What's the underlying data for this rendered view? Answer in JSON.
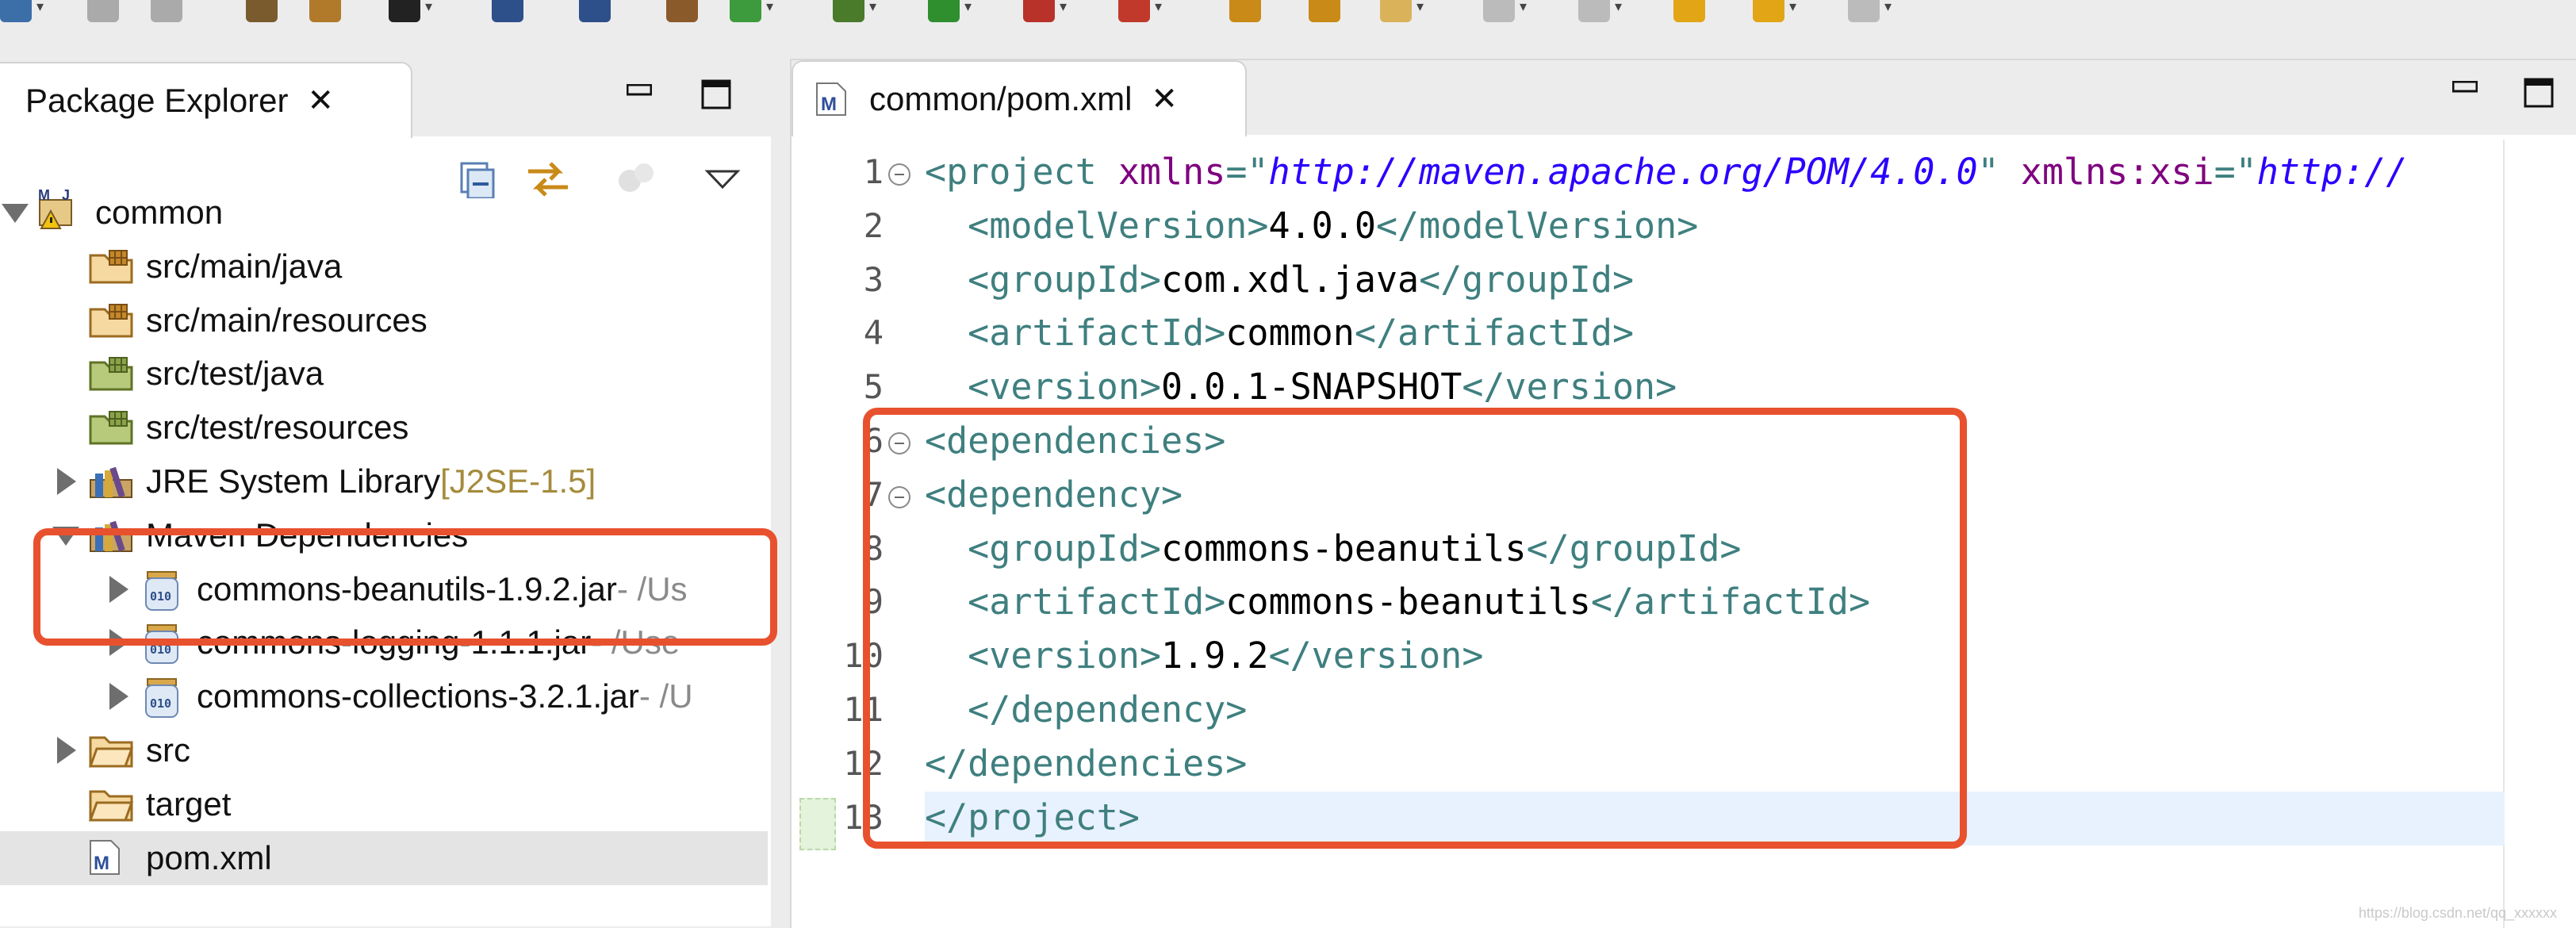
{
  "toolbar": {
    "items": [
      "new-icon",
      "save-icon",
      "save-all-icon",
      "tool-icon",
      "refresh-icon",
      "avatar-icon",
      "monitor-icon",
      "search-icon",
      "package-icon",
      "sync-icon",
      "debug-icon",
      "run-icon",
      "run-config-icon",
      "external-tools-icon",
      "open-folder-icon",
      "open-file-icon",
      "pen-icon",
      "task-icon",
      "up-icon",
      "back-icon",
      "back-history-icon",
      "forward-icon"
    ]
  },
  "explorer": {
    "title": "Package Explorer",
    "tree": [
      {
        "label": "common",
        "icon": "maven-project-icon",
        "expanded": true,
        "level": 0
      },
      {
        "label": "src/main/java",
        "icon": "source-folder-icon",
        "level": 1
      },
      {
        "label": "src/main/resources",
        "icon": "source-folder-icon",
        "level": 1
      },
      {
        "label": "src/test/java",
        "icon": "test-source-folder-icon",
        "level": 1
      },
      {
        "label": "src/test/resources",
        "icon": "test-source-folder-icon",
        "level": 1
      },
      {
        "label": "JRE System Library",
        "decoration": "[J2SE-1.5]",
        "icon": "library-icon",
        "expanded": false,
        "level": 1
      },
      {
        "label": "Maven Dependencies",
        "icon": "library-icon",
        "expanded": true,
        "level": 1
      },
      {
        "label": "commons-beanutils-1.9.2.jar",
        "path": "- /Us",
        "icon": "jar-icon",
        "expanded": false,
        "level": 2
      },
      {
        "label": "commons-logging-1.1.1.jar",
        "path": "- /Use",
        "icon": "jar-icon",
        "expanded": false,
        "level": 2
      },
      {
        "label": "commons-collections-3.2.1.jar",
        "path": "- /U",
        "icon": "jar-icon",
        "expanded": false,
        "level": 2
      },
      {
        "label": "src",
        "icon": "folder-icon",
        "expanded": false,
        "level": 1
      },
      {
        "label": "target",
        "icon": "folder-icon",
        "level": 1
      },
      {
        "label": "pom.xml",
        "icon": "pom-file-icon",
        "selected": true,
        "level": 1
      }
    ]
  },
  "editor": {
    "tab_label": "common/pom.xml",
    "lines": [
      {
        "num": "1",
        "fold": true,
        "tokens": [
          [
            "tag",
            "<project "
          ],
          [
            "attr",
            "xmlns"
          ],
          [
            "tag",
            "=\""
          ],
          [
            "val",
            "http://maven.apache.org/POM/4.0.0"
          ],
          [
            "tag",
            "\" "
          ],
          [
            "attr",
            "xmlns:xsi"
          ],
          [
            "tag",
            "=\""
          ],
          [
            "val",
            "http://"
          ]
        ]
      },
      {
        "num": "2",
        "tokens": [
          [
            "tag",
            "  <modelVersion>"
          ],
          [
            "text",
            "4.0.0"
          ],
          [
            "tag",
            "</modelVersion>"
          ]
        ]
      },
      {
        "num": "3",
        "tokens": [
          [
            "tag",
            "  <groupId>"
          ],
          [
            "text",
            "com.xdl.java"
          ],
          [
            "tag",
            "</groupId>"
          ]
        ]
      },
      {
        "num": "4",
        "tokens": [
          [
            "tag",
            "  <artifactId>"
          ],
          [
            "text",
            "common"
          ],
          [
            "tag",
            "</artifactId>"
          ]
        ]
      },
      {
        "num": "5",
        "tokens": [
          [
            "tag",
            "  <version>"
          ],
          [
            "text",
            "0.0.1-SNAPSHOT"
          ],
          [
            "tag",
            "</version>"
          ]
        ]
      },
      {
        "num": "6",
        "fold": true,
        "tokens": [
          [
            "tag",
            "<dependencies>"
          ]
        ]
      },
      {
        "num": "7",
        "fold": true,
        "tokens": [
          [
            "tag",
            "<dependency>"
          ]
        ]
      },
      {
        "num": "8",
        "tokens": [
          [
            "tag",
            "  <groupId>"
          ],
          [
            "text",
            "commons-beanutils"
          ],
          [
            "tag",
            "</groupId>"
          ]
        ]
      },
      {
        "num": "9",
        "tokens": [
          [
            "tag",
            "  <artifactId>"
          ],
          [
            "text",
            "commons-beanutils"
          ],
          [
            "tag",
            "</artifactId>"
          ]
        ]
      },
      {
        "num": "10",
        "tokens": [
          [
            "tag",
            "  <version>"
          ],
          [
            "text",
            "1.9.2"
          ],
          [
            "tag",
            "</version>"
          ]
        ]
      },
      {
        "num": "11",
        "tokens": [
          [
            "tag",
            "  </dependency>"
          ]
        ]
      },
      {
        "num": "12",
        "tokens": [
          [
            "tag",
            "</dependencies>"
          ]
        ]
      },
      {
        "num": "13",
        "current": true,
        "tokens": [
          [
            "tag",
            "</project>"
          ]
        ]
      }
    ]
  },
  "colors": {
    "annotation": "#e8512e",
    "xml_tag": "#3f7f7f",
    "xml_attr": "#7f007f",
    "xml_value": "#2a00ff"
  },
  "watermark": "https://blog.csdn.net/qq_xxxxxx"
}
